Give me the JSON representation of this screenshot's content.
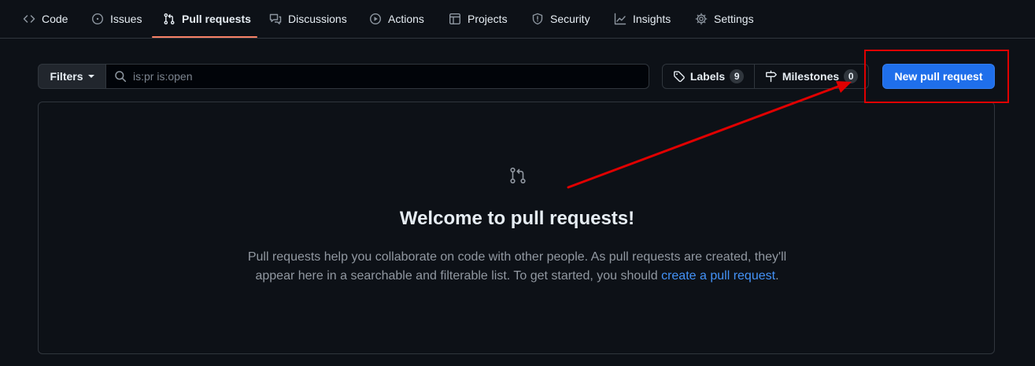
{
  "nav": {
    "code": "Code",
    "issues": "Issues",
    "pull_requests": "Pull requests",
    "discussions": "Discussions",
    "actions": "Actions",
    "projects": "Projects",
    "security": "Security",
    "insights": "Insights",
    "settings": "Settings"
  },
  "filters": {
    "button_label": "Filters",
    "search_value": "is:pr is:open",
    "labels_label": "Labels",
    "labels_count": "9",
    "milestones_label": "Milestones",
    "milestones_count": "0",
    "new_pr_label": "New pull request"
  },
  "blankslate": {
    "title": "Welcome to pull requests!",
    "description_line1": "Pull requests help you collaborate on code with other people. As pull requests are created, they'll",
    "description_line2": "appear here in a searchable and filterable list. To get started, you should ",
    "link_text": "create a pull request",
    "suffix": "."
  },
  "colors": {
    "background": "#0d1117",
    "accent_underline": "#f78166",
    "primary_button": "#1f6feb",
    "annotation_red": "#e00000",
    "link": "#4493f8"
  },
  "icons": [
    "code-icon",
    "issue-icon",
    "pull-request-icon",
    "discussion-icon",
    "play-icon",
    "table-icon",
    "shield-icon",
    "graph-icon",
    "gear-icon",
    "search-icon",
    "tag-icon",
    "milestone-icon"
  ]
}
